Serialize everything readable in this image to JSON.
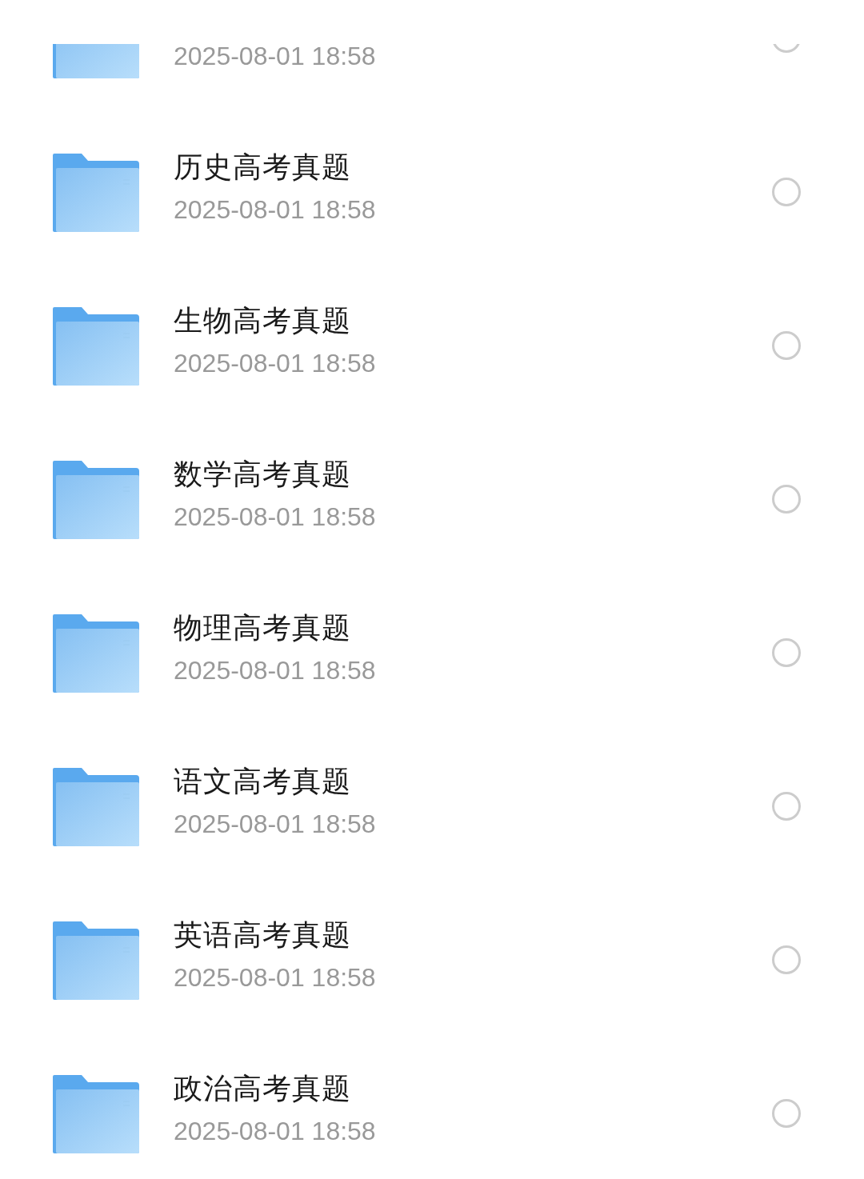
{
  "files": [
    {
      "date": "2025-08-01 18:58",
      "selected": false
    },
    {
      "name": "历史高考真题",
      "date": "2025-08-01 18:58",
      "selected": false
    },
    {
      "name": "生物高考真题",
      "date": "2025-08-01 18:58",
      "selected": false
    },
    {
      "name": "数学高考真题",
      "date": "2025-08-01 18:58",
      "selected": false
    },
    {
      "name": "物理高考真题",
      "date": "2025-08-01 18:58",
      "selected": false
    },
    {
      "name": "语文高考真题",
      "date": "2025-08-01 18:58",
      "selected": false
    },
    {
      "name": "英语高考真题",
      "date": "2025-08-01 18:58",
      "selected": false
    },
    {
      "name": "政治高考真题",
      "date": "2025-08-01 18:58",
      "selected": false
    }
  ]
}
